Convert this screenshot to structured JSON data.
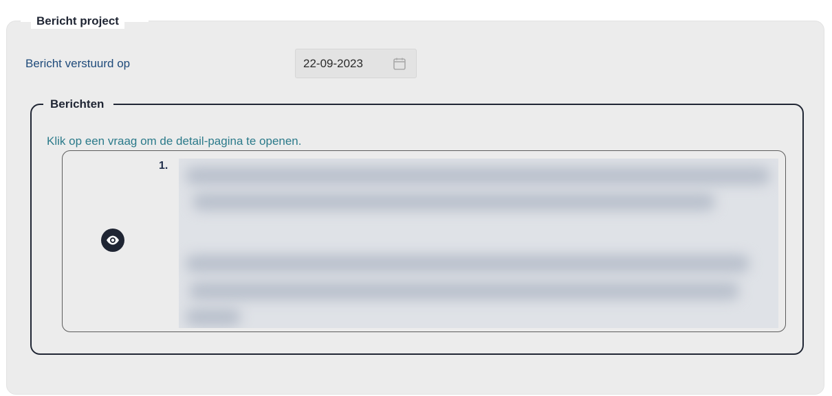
{
  "section": {
    "title": "Bericht project"
  },
  "sent_on": {
    "label": "Bericht verstuurd op",
    "value": "22-09-2023",
    "icon": "calendar-icon"
  },
  "messages": {
    "title": "Berichten",
    "hint": "Klik op een vraag om de detail-pagina te openen.",
    "items": [
      {
        "number": "1.",
        "view_icon": "eye-icon"
      }
    ]
  },
  "colors": {
    "panel_bg": "#ececec",
    "dark": "#1f2533",
    "label_blue": "#1e4a7a",
    "hint_teal": "#2b7a8a"
  }
}
